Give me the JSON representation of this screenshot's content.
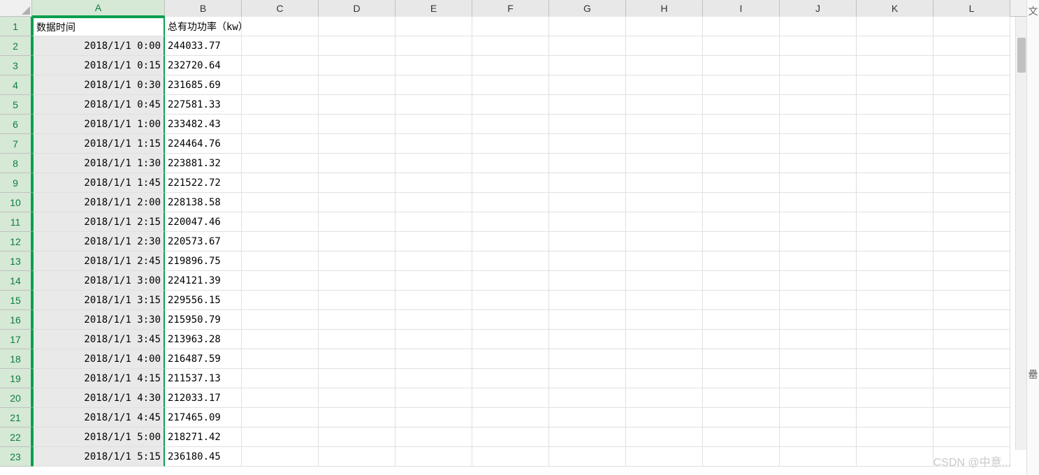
{
  "columns": [
    "A",
    "B",
    "C",
    "D",
    "E",
    "F",
    "G",
    "H",
    "I",
    "J",
    "K",
    "L"
  ],
  "selected_column": "A",
  "header_row": {
    "A": "数据时间",
    "B": "总有功功率（kw）"
  },
  "rows": [
    {
      "n": 1,
      "A": "数据时间",
      "B": "总有功功率（kw）"
    },
    {
      "n": 2,
      "A": "2018/1/1  0:00",
      "B": "244033.77"
    },
    {
      "n": 3,
      "A": "2018/1/1  0:15",
      "B": "232720.64"
    },
    {
      "n": 4,
      "A": "2018/1/1  0:30",
      "B": "231685.69"
    },
    {
      "n": 5,
      "A": "2018/1/1  0:45",
      "B": "227581.33"
    },
    {
      "n": 6,
      "A": "2018/1/1  1:00",
      "B": "233482.43"
    },
    {
      "n": 7,
      "A": "2018/1/1  1:15",
      "B": "224464.76"
    },
    {
      "n": 8,
      "A": "2018/1/1  1:30",
      "B": "223881.32"
    },
    {
      "n": 9,
      "A": "2018/1/1  1:45",
      "B": "221522.72"
    },
    {
      "n": 10,
      "A": "2018/1/1  2:00",
      "B": "228138.58"
    },
    {
      "n": 11,
      "A": "2018/1/1  2:15",
      "B": "220047.46"
    },
    {
      "n": 12,
      "A": "2018/1/1  2:30",
      "B": "220573.67"
    },
    {
      "n": 13,
      "A": "2018/1/1  2:45",
      "B": "219896.75"
    },
    {
      "n": 14,
      "A": "2018/1/1  3:00",
      "B": "224121.39"
    },
    {
      "n": 15,
      "A": "2018/1/1  3:15",
      "B": "229556.15"
    },
    {
      "n": 16,
      "A": "2018/1/1  3:30",
      "B": "215950.79"
    },
    {
      "n": 17,
      "A": "2018/1/1  3:45",
      "B": "213963.28"
    },
    {
      "n": 18,
      "A": "2018/1/1  4:00",
      "B": "216487.59"
    },
    {
      "n": 19,
      "A": "2018/1/1  4:15",
      "B": "211537.13"
    },
    {
      "n": 20,
      "A": "2018/1/1  4:30",
      "B": "212033.17"
    },
    {
      "n": 21,
      "A": "2018/1/1  4:45",
      "B": "217465.09"
    },
    {
      "n": 22,
      "A": "2018/1/1  5:00",
      "B": "218271.42"
    },
    {
      "n": 23,
      "A": "2018/1/1  5:15",
      "B": "236180.45"
    }
  ],
  "watermark": "CSDN @中意...",
  "side_labels": {
    "top": "文",
    "bottom": "罍"
  }
}
